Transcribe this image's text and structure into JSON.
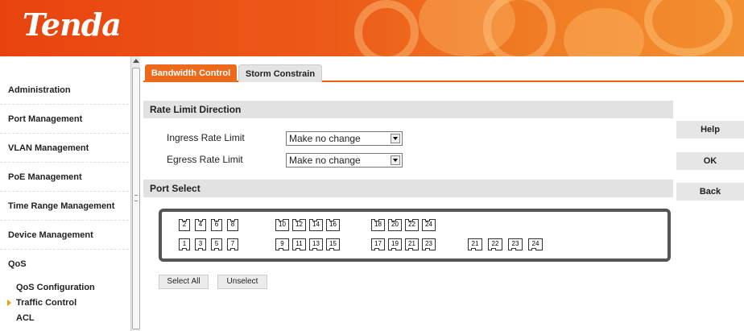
{
  "brand": {
    "logo": "Tenda"
  },
  "sidebar": {
    "items": [
      {
        "label": "Administration"
      },
      {
        "label": "Port Management"
      },
      {
        "label": "VLAN Management"
      },
      {
        "label": "PoE Management"
      },
      {
        "label": "Time Range Management"
      },
      {
        "label": "Device Management"
      },
      {
        "label": "QoS"
      }
    ],
    "sub_items": [
      {
        "label": "QoS Configuration"
      },
      {
        "label": "Traffic Control"
      },
      {
        "label": "ACL"
      }
    ]
  },
  "tabs": [
    {
      "label": "Bandwidth Control"
    },
    {
      "label": "Storm Constrain"
    }
  ],
  "rate_limit": {
    "title": "Rate Limit Direction",
    "ingress_label": "Ingress Rate Limit",
    "ingress_value": "Make no change",
    "egress_label": "Egress Rate Limit",
    "egress_value": "Make no change"
  },
  "port_select": {
    "title": "Port Select",
    "top_row": [
      "2",
      "4",
      "6",
      "8",
      "10",
      "12",
      "14",
      "16",
      "18",
      "20",
      "22",
      "24"
    ],
    "bottom_row": [
      "1",
      "3",
      "5",
      "7",
      "9",
      "11",
      "13",
      "15",
      "17",
      "19",
      "21",
      "23"
    ],
    "sfp_row": [
      "21",
      "22",
      "23",
      "24"
    ],
    "select_all": "Select All",
    "unselect": "Unselect"
  },
  "actions": {
    "help": "Help",
    "ok": "OK",
    "back": "Back"
  },
  "colors": {
    "header": "#ec5a18",
    "tab_active": "#ec6a1a",
    "accent_arrow": "#f0a000"
  }
}
